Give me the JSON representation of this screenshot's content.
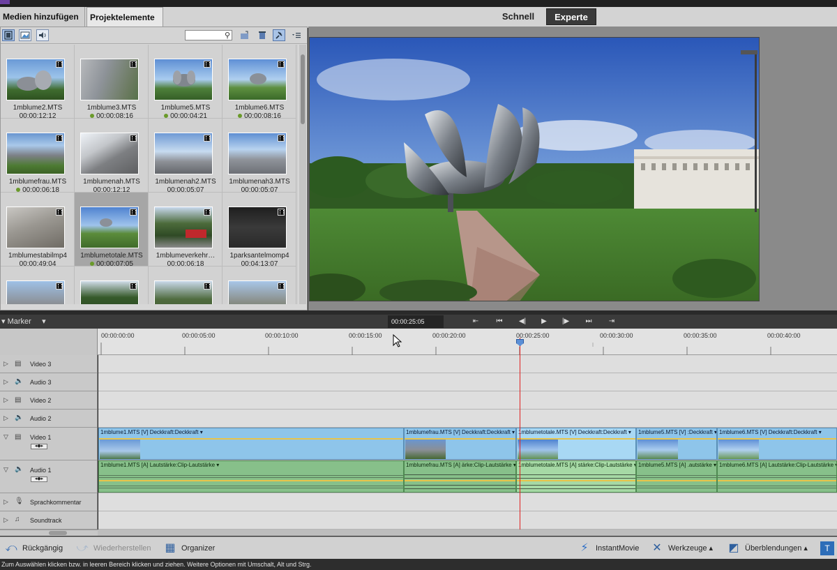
{
  "menu": {
    "media_label": "Medien hinzufügen",
    "project_label": "Projektelemente",
    "quick_label": "Schnell",
    "expert_label": "Experte"
  },
  "project": {
    "items": [
      {
        "name": "1mblume2.MTS",
        "duration": "00:00:12:12",
        "used": false
      },
      {
        "name": "1mblume3.MTS",
        "duration": "00:00:08:16",
        "used": true
      },
      {
        "name": "1mblume5.MTS",
        "duration": "00:00:04:21",
        "used": true
      },
      {
        "name": "1mblume6.MTS",
        "duration": "00:00:08:16",
        "used": true
      },
      {
        "name": "1mblumefrau.MTS",
        "duration": "00:00:06:18",
        "used": true
      },
      {
        "name": "1mblumenah.MTS",
        "duration": "00:00:12:12",
        "used": false
      },
      {
        "name": "1mblumenah2.MTS",
        "duration": "00:00:05:07",
        "used": false
      },
      {
        "name": "1mblumenah3.MTS",
        "duration": "00:00:05:07",
        "used": false
      },
      {
        "name": "1mblumestabilmp4",
        "duration": "00:00:49:04",
        "used": false
      },
      {
        "name": "1mblumetotale.MTS",
        "duration": "00:00:07:05",
        "used": true
      },
      {
        "name": "1mblumeverkehr…",
        "duration": "00:00:06:18",
        "used": false
      },
      {
        "name": "1parksantelmomp4",
        "duration": "00:04:13:07",
        "used": false
      }
    ]
  },
  "playback": {
    "marker_label": "Marker",
    "timecode": "00:00:25:05"
  },
  "ruler": {
    "ticks": [
      "00:00:00:00",
      "00:00:05:00",
      "00:00:10:00",
      "00:00:15:00",
      "00:00:20:00",
      "00:00:25:00",
      "00:00:30:00",
      "00:00:35:00",
      "00:00:40:00"
    ]
  },
  "tracks": {
    "video3": "Video 3",
    "audio3": "Audio 3",
    "video2": "Video 2",
    "audio2": "Audio 2",
    "video1": "Video 1",
    "audio1": "Audio 1",
    "narration": "Sprachkommentar",
    "soundtrack": "Soundtrack"
  },
  "clips": {
    "video": [
      "1mblume1.MTS [V]  Deckkraft:Deckkraft ▾",
      "1mblumefrau.MTS [V]  Deckkraft:Deckkraft ▾",
      "1mblumetotale.MTS [V]  Deckkraft:Deckkraft ▾",
      "1mblume5.MTS [V]  :Deckkraft ▾",
      "1mblume6.MTS [V]  Deckkraft:Deckkraft ▾"
    ],
    "audio": [
      "1mblume1.MTS [A]  Lautstärke:Clip-Lautstärke ▾",
      "1mblumefrau.MTS [A]  ärke:Clip-Lautstärke ▾",
      "1mblumetotale.MTS [A]  stärke:Clip-Lautstärke ▾",
      "1mblume5.MTS [A]  .autstärke ▾",
      "1mblume6.MTS [A]  Lautstärke:Clip-Lautstärke ▾"
    ]
  },
  "actions": {
    "undo": "Rückgängig",
    "redo": "Wiederherstellen",
    "organizer": "Organizer",
    "instantmovie": "InstantMovie",
    "tools": "Werkzeuge",
    "transitions": "Überblendungen"
  },
  "status": "Zum Auswählen klicken bzw. in leeren Bereich klicken und ziehen. Weitere Optionen mit Umschalt, Alt und Strg."
}
